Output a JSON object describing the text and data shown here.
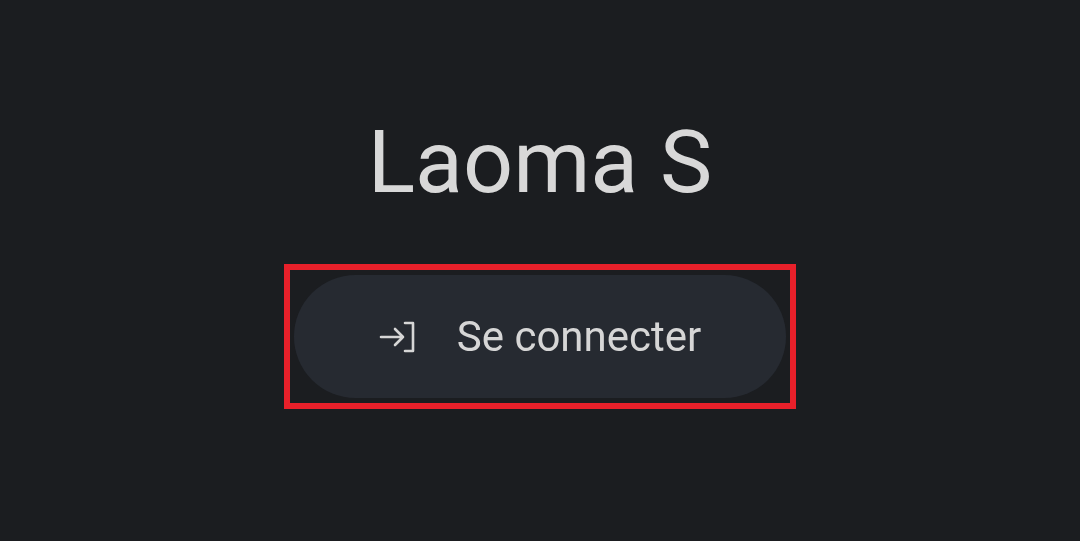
{
  "title": "Laoma S",
  "button": {
    "label": "Se connecter",
    "highlighted": true
  }
}
